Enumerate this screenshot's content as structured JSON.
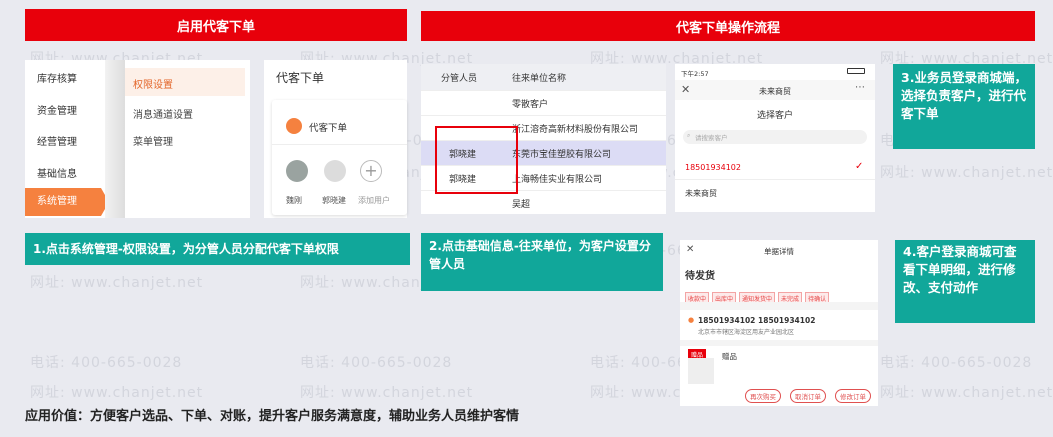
{
  "watermarks": {
    "url": "网址: www.chanjet.net",
    "phone": "电话: 400-665-0028"
  },
  "section1": {
    "title": "启用代客下单",
    "menu": [
      "库存核算",
      "资金管理",
      "经营管理",
      "基础信息",
      "系统管理"
    ],
    "submenu": [
      "权限设置",
      "消息通道设置",
      "菜单管理"
    ],
    "panel_title": "代客下单",
    "card_title": "代客下单",
    "users": [
      "魏刚",
      "郭晓建",
      "添加用户"
    ],
    "caption": "1.点击系统管理-权限设置，为分管人员分配代客下单权限"
  },
  "section2": {
    "title": "代客下单操作流程",
    "table": {
      "headers": [
        "分管人员",
        "往来单位名称"
      ],
      "rows": [
        {
          "person": "",
          "unit": "零散客户"
        },
        {
          "person": "",
          "unit": "浙江溶奇高新材料股份有限公司"
        },
        {
          "person": "郭晓建",
          "unit": "东莞市宝佳塑胶有限公司"
        },
        {
          "person": "郭晓建",
          "unit": "上海畅佳实业有限公司"
        },
        {
          "person": "",
          "unit": "吴超"
        }
      ]
    },
    "caption": "2.点击基础信息-往来单位，为客户设置分管人员"
  },
  "phone1": {
    "status_time": "下午2:57",
    "nav_title": "未来商贸",
    "heading": "选择客户",
    "search_placeholder": "请搜索客户",
    "customers": [
      "18501934102",
      "未来商贸"
    ]
  },
  "step3": "3.业务员登录商城端，选择负责客户，进行代客下单",
  "phone2": {
    "nav_title": "单据详情",
    "status": "待发货",
    "tags": [
      "收款中",
      "出库中",
      "通知发货中",
      "未完成",
      "待确认"
    ],
    "contact": "18501934102 18501934102",
    "address": "北京市市辖区海淀区用友产业园北区",
    "gift_badge": "赠品",
    "gift_label": "赠品",
    "buttons": [
      "再次购买",
      "取消订单",
      "修改订单"
    ]
  },
  "step4": "4.客户登录商城可查看下单明细，进行修改、支付动作",
  "footer": "应用价值：方便客户选品、下单、对账，提升客户服务满意度，辅助业务人员维护客情",
  "colors": {
    "red": "#e8000b",
    "teal": "#11a79a",
    "orange": "#f5813f"
  }
}
